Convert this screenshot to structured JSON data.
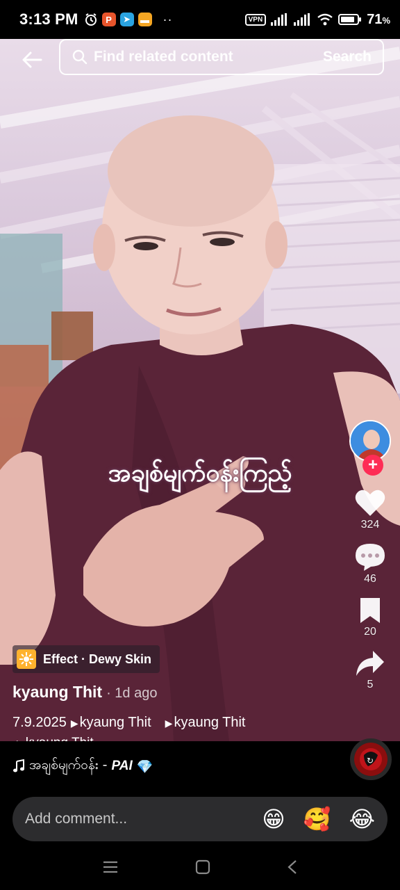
{
  "status_bar": {
    "time": "3:13 PM",
    "vpn": "VPN",
    "battery": "71",
    "battery_unit": "%",
    "more": "··"
  },
  "top": {
    "search_placeholder": "Find related content",
    "search_button": "Search"
  },
  "video": {
    "caption": "အချစ်မျက်ဝန်းကြည့်"
  },
  "rail": {
    "likes": "324",
    "comments": "46",
    "saves": "20",
    "shares": "5",
    "follow_plus": "+"
  },
  "post": {
    "effect_label": "Effect · Dewy Skin",
    "author": "kyaung Thit",
    "age": "· 1d ago",
    "desc_date": "7.9.2025",
    "tags": [
      "kyaung Thit",
      "kyaung Thit",
      "kyaung Thit"
    ]
  },
  "music": {
    "title": "အချစ်မျက်ဝန်း -",
    "artist": "PAI",
    "gem": "💎"
  },
  "comment": {
    "placeholder": "Add comment...",
    "emojis": [
      "😁",
      "🥰",
      "😂"
    ]
  },
  "colors": {
    "accent": "#fe2c55",
    "robe": "#5a2438",
    "effect_chip": "#ffb22e"
  },
  "icons": [
    "back-arrow-icon",
    "search-icon",
    "heart-icon",
    "comment-icon",
    "bookmark-icon",
    "share-icon",
    "music-note-icon",
    "menu-icon",
    "home-icon",
    "back-icon"
  ]
}
